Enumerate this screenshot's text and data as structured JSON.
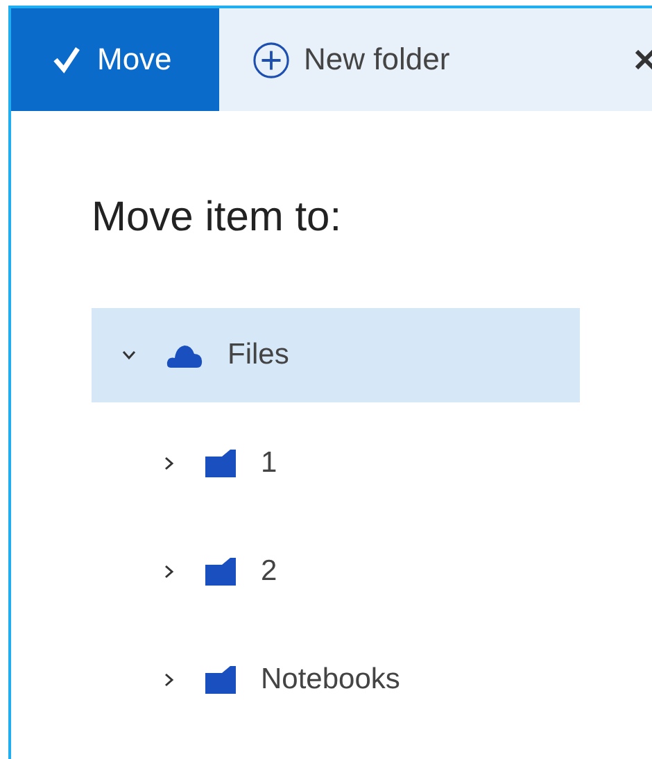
{
  "toolbar": {
    "move_button": "Move",
    "new_folder_button": "New folder"
  },
  "heading": "Move item to:",
  "tree": [
    {
      "label": "Files",
      "kind": "cloud",
      "selected": true,
      "expanded": true,
      "children": [
        {
          "label": "1",
          "kind": "folder",
          "selected": false,
          "expanded": false
        },
        {
          "label": "2",
          "kind": "folder",
          "selected": false,
          "expanded": false
        },
        {
          "label": "Notebooks",
          "kind": "folder",
          "selected": false,
          "expanded": false
        }
      ]
    }
  ]
}
